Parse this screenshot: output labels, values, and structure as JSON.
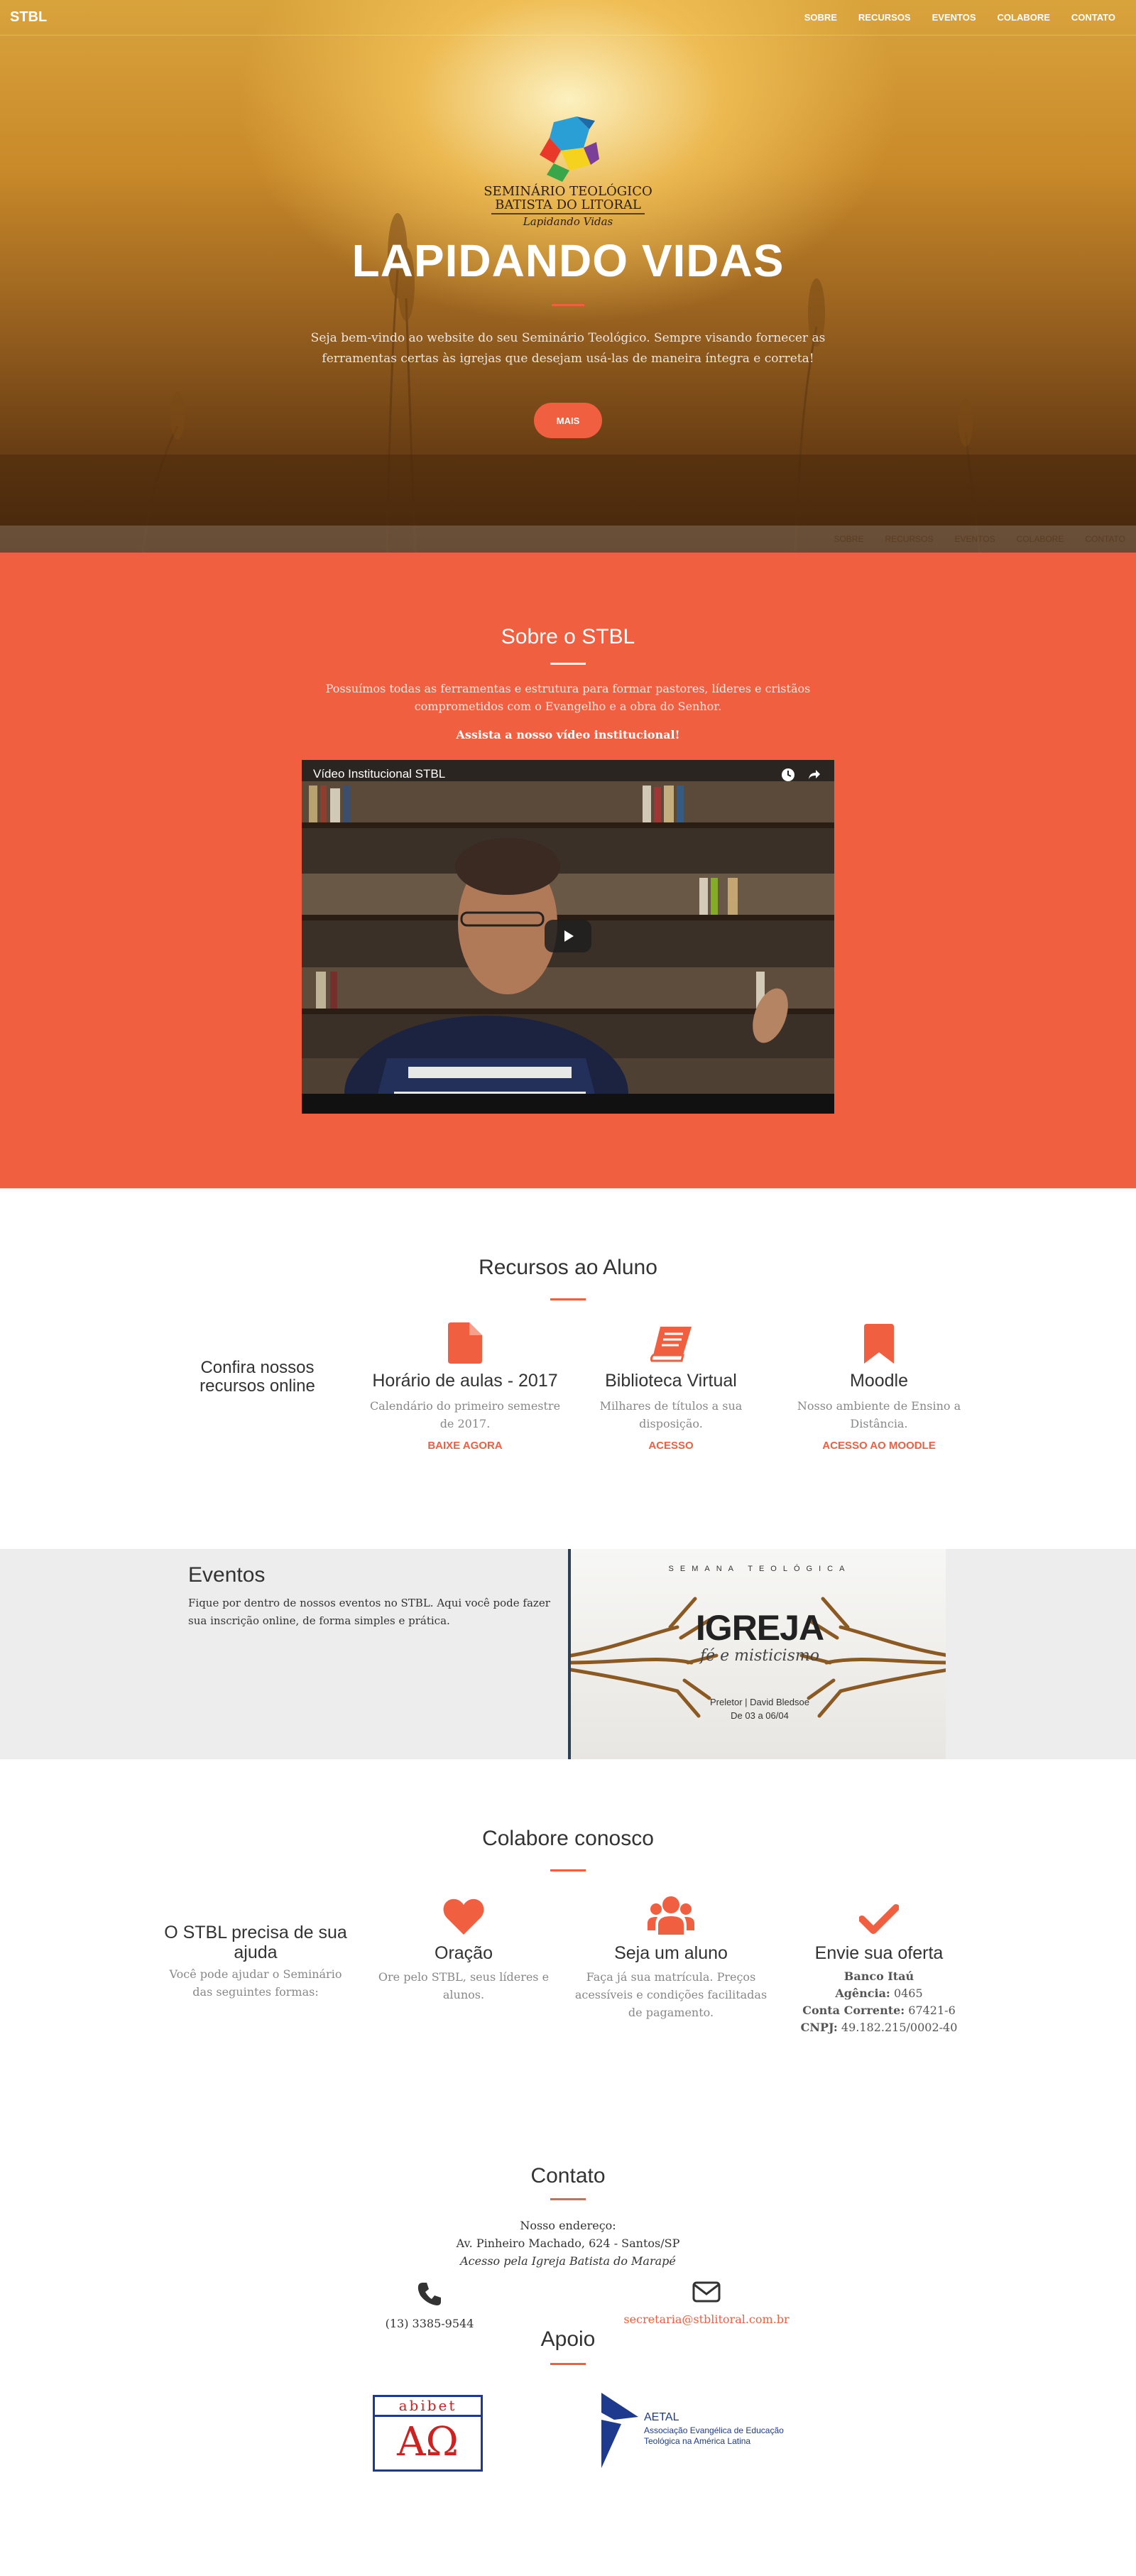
{
  "nav": {
    "brand": "STBL",
    "links": [
      "SOBRE",
      "RECURSOS",
      "EVENTOS",
      "COLABORE",
      "CONTATO"
    ],
    "ghost_links": [
      "SOBRE",
      "RECURSOS",
      "EVENTOS",
      "COLABORE",
      "CONTATO"
    ]
  },
  "hero": {
    "logo_line1": "SEMINÁRIO TEOLÓGICO",
    "logo_line2": "BATISTA DO LITORAL",
    "logo_tagline": "Lapidando Vidas",
    "title": "LAPIDANDO VIDAS",
    "subtitle": "Seja bem-vindo ao website do seu Seminário Teológico. Sempre visando fornecer as ferramentas certas às igrejas que desejam usá-las de maneira íntegra e correta!",
    "button": "MAIS"
  },
  "sobre": {
    "title": "Sobre o STBL",
    "lead": "Possuímos todas as ferramentas e estrutura para formar pastores, líderes e cristãos comprometidos com o Evangelho e a obra do Senhor.",
    "watch": "Assista a nosso vídeo institucional!",
    "video_title": "Vídeo Institucional STBL"
  },
  "recursos": {
    "title": "Recursos ao Aluno",
    "intro": "Confira nossos recursos online",
    "items": [
      {
        "icon": "file-icon",
        "title": "Horário de aulas - 2017",
        "text": "Calendário do primeiro semestre de 2017.",
        "link": "BAIXE AGORA"
      },
      {
        "icon": "book-icon",
        "title": "Biblioteca Virtual",
        "text": "Milhares de títulos a sua disposição.",
        "link": "ACESSO"
      },
      {
        "icon": "bookmark-icon",
        "title": "Moodle",
        "text": "Nosso ambiente de Ensino a Distância.",
        "link": "ACESSO AO MOODLE"
      }
    ]
  },
  "eventos": {
    "title": "Eventos",
    "text": "Fique por dentro de nossos eventos no STBL. Aqui você pode fazer sua inscrição online, de forma simples e prática.",
    "poster_kicker": "SEMANA TEOLÓGICA",
    "poster_title": "IGREJA",
    "poster_subtitle": "fé e misticismo",
    "poster_info1": "Preletor | David Bledsoe",
    "poster_info2": "De 03 a 06/04"
  },
  "colabore": {
    "title": "Colabore conosco",
    "intro_title": "O STBL precisa de sua ajuda",
    "intro_text": "Você pode ajudar o Seminário das seguintes formas:",
    "items": [
      {
        "icon": "heart-icon",
        "title": "Oração",
        "text": "Ore pelo STBL, seus líderes e alunos."
      },
      {
        "icon": "users-icon",
        "title": "Seja um aluno",
        "text": "Faça já sua matrícula. Preços acessíveis e condições facilitadas de pagamento."
      }
    ],
    "oferta": {
      "icon": "check-icon",
      "title": "Envie sua oferta",
      "bank": "Banco Itaú",
      "agencia_label": "Agência:",
      "agencia": "0465",
      "conta_label": "Conta Corrente:",
      "conta": "67421-6",
      "cnpj_label": "CNPJ:",
      "cnpj": "49.182.215/0002-40"
    }
  },
  "contato": {
    "title": "Contato",
    "addr_label": "Nosso endereço:",
    "addr": "Av. Pinheiro Machado, 624 - Santos/SP",
    "addr_note": "Acesso pela Igreja Batista do Marapé",
    "phone": "(13) 3385-9544",
    "email": "secretaria@stblitoral.com.br"
  },
  "apoio": {
    "title": "Apoio",
    "abibet_name": "abibet",
    "abibet_mark": "ΑΩ",
    "aetal_name": "AETAL",
    "aetal_desc": "Associação Evangélica de Educação Teológica na América Latina"
  },
  "colors": {
    "accent": "#f05f40",
    "dark": "#333333",
    "muted": "#888888",
    "light_bg": "#ededed"
  }
}
